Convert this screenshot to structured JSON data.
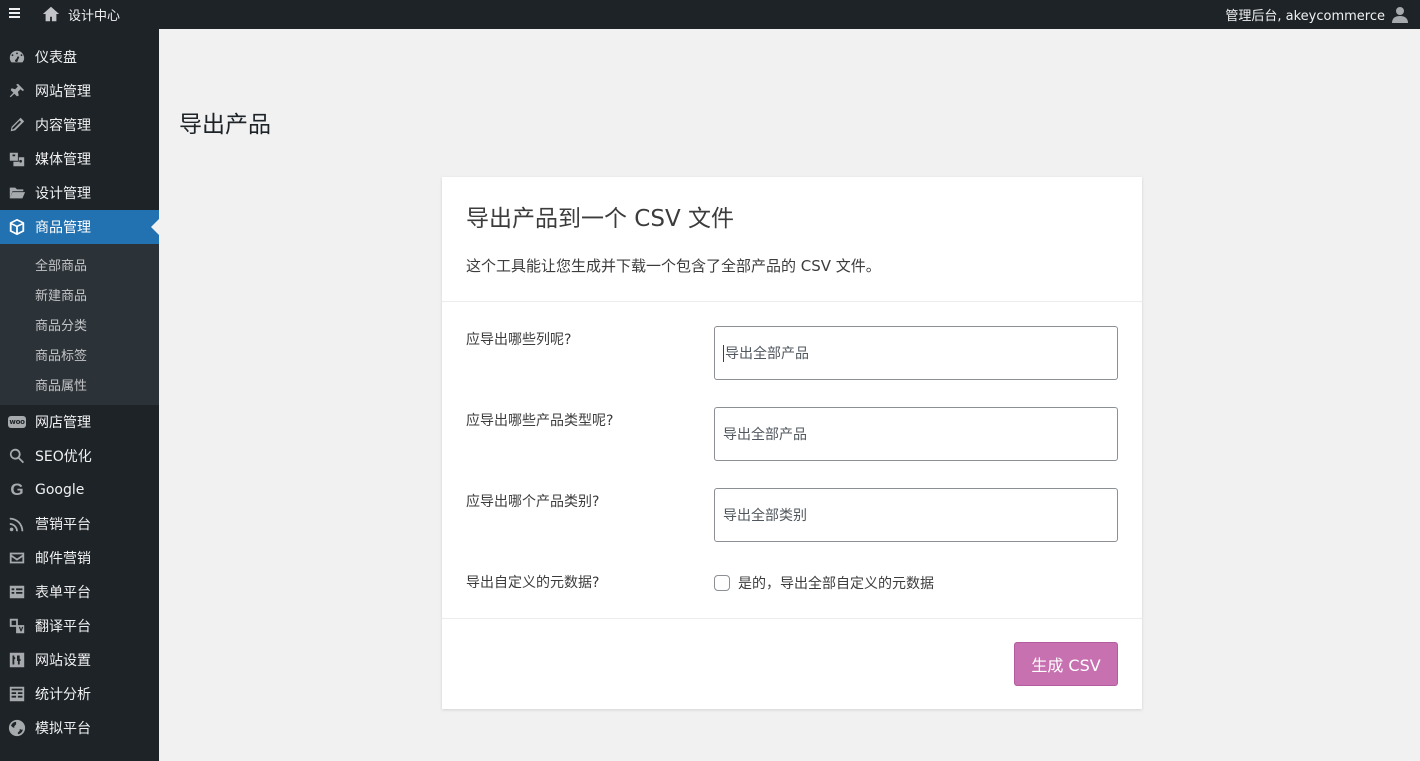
{
  "adminbar": {
    "site_name": "设计中心",
    "account_text": "管理后台, akeycommerce"
  },
  "sidebar": {
    "items_top": [
      {
        "label": "仪表盘",
        "icon": "dashboard-icon"
      },
      {
        "label": "网站管理",
        "icon": "pin-icon"
      },
      {
        "label": "内容管理",
        "icon": "pencil-icon"
      },
      {
        "label": "媒体管理",
        "icon": "media-icon"
      },
      {
        "label": "设计管理",
        "icon": "folder-icon"
      },
      {
        "label": "商品管理",
        "icon": "box-icon",
        "active": true
      }
    ],
    "submenu": [
      "全部商品",
      "新建商品",
      "商品分类",
      "商品标签",
      "商品属性"
    ],
    "items_bottom": [
      {
        "label": "网店管理",
        "icon": "woo-icon"
      },
      {
        "label": "SEO优化",
        "icon": "search-icon"
      },
      {
        "label": "Google",
        "icon": "google-icon"
      },
      {
        "label": "营销平台",
        "icon": "rss-icon"
      },
      {
        "label": "邮件营销",
        "icon": "mail-icon"
      },
      {
        "label": "表单平台",
        "icon": "form-icon"
      },
      {
        "label": "翻译平台",
        "icon": "translate-icon"
      },
      {
        "label": "网站设置",
        "icon": "settings-icon"
      },
      {
        "label": "统计分析",
        "icon": "analytics-icon"
      },
      {
        "label": "模拟平台",
        "icon": "globe-icon"
      }
    ]
  },
  "main": {
    "page_title": "导出产品",
    "card": {
      "title": "导出产品到一个 CSV 文件",
      "description": "这个工具能让您生成并下载一个包含了全部产品的 CSV 文件。",
      "rows": [
        {
          "label": "应导出哪些列呢?",
          "placeholder": "导出全部产品"
        },
        {
          "label": "应导出哪些产品类型呢?",
          "placeholder": "导出全部产品"
        },
        {
          "label": "应导出哪个产品类别?",
          "placeholder": "导出全部类别"
        }
      ],
      "meta_label": "导出自定义的元数据?",
      "meta_checkbox_label": "是的，导出全部自定义的元数据",
      "button_label": "生成 CSV"
    }
  }
}
